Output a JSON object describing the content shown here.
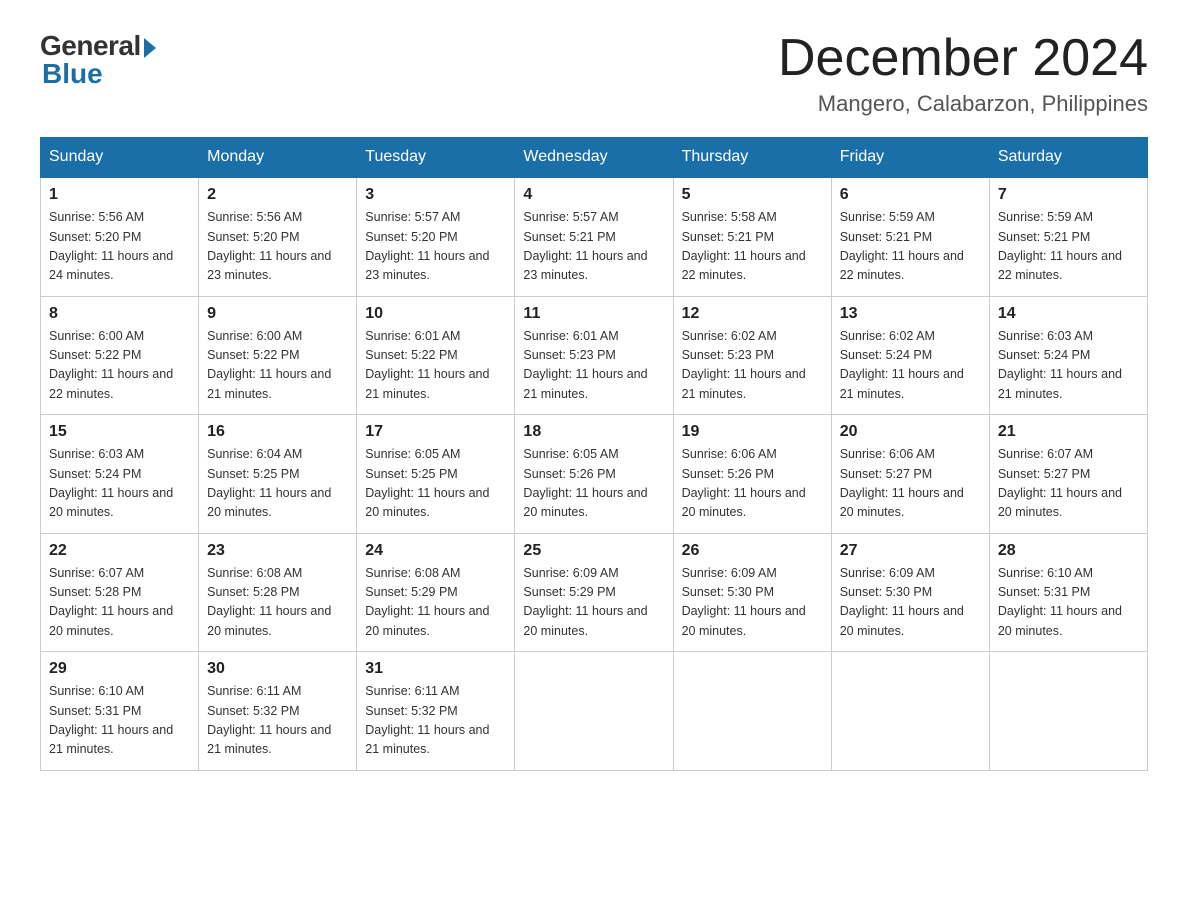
{
  "header": {
    "logo_general": "General",
    "logo_blue": "Blue",
    "month_title": "December 2024",
    "location": "Mangero, Calabarzon, Philippines"
  },
  "weekdays": [
    "Sunday",
    "Monday",
    "Tuesday",
    "Wednesday",
    "Thursday",
    "Friday",
    "Saturday"
  ],
  "weeks": [
    [
      {
        "day": "1",
        "sunrise": "Sunrise: 5:56 AM",
        "sunset": "Sunset: 5:20 PM",
        "daylight": "Daylight: 11 hours and 24 minutes."
      },
      {
        "day": "2",
        "sunrise": "Sunrise: 5:56 AM",
        "sunset": "Sunset: 5:20 PM",
        "daylight": "Daylight: 11 hours and 23 minutes."
      },
      {
        "day": "3",
        "sunrise": "Sunrise: 5:57 AM",
        "sunset": "Sunset: 5:20 PM",
        "daylight": "Daylight: 11 hours and 23 minutes."
      },
      {
        "day": "4",
        "sunrise": "Sunrise: 5:57 AM",
        "sunset": "Sunset: 5:21 PM",
        "daylight": "Daylight: 11 hours and 23 minutes."
      },
      {
        "day": "5",
        "sunrise": "Sunrise: 5:58 AM",
        "sunset": "Sunset: 5:21 PM",
        "daylight": "Daylight: 11 hours and 22 minutes."
      },
      {
        "day": "6",
        "sunrise": "Sunrise: 5:59 AM",
        "sunset": "Sunset: 5:21 PM",
        "daylight": "Daylight: 11 hours and 22 minutes."
      },
      {
        "day": "7",
        "sunrise": "Sunrise: 5:59 AM",
        "sunset": "Sunset: 5:21 PM",
        "daylight": "Daylight: 11 hours and 22 minutes."
      }
    ],
    [
      {
        "day": "8",
        "sunrise": "Sunrise: 6:00 AM",
        "sunset": "Sunset: 5:22 PM",
        "daylight": "Daylight: 11 hours and 22 minutes."
      },
      {
        "day": "9",
        "sunrise": "Sunrise: 6:00 AM",
        "sunset": "Sunset: 5:22 PM",
        "daylight": "Daylight: 11 hours and 21 minutes."
      },
      {
        "day": "10",
        "sunrise": "Sunrise: 6:01 AM",
        "sunset": "Sunset: 5:22 PM",
        "daylight": "Daylight: 11 hours and 21 minutes."
      },
      {
        "day": "11",
        "sunrise": "Sunrise: 6:01 AM",
        "sunset": "Sunset: 5:23 PM",
        "daylight": "Daylight: 11 hours and 21 minutes."
      },
      {
        "day": "12",
        "sunrise": "Sunrise: 6:02 AM",
        "sunset": "Sunset: 5:23 PM",
        "daylight": "Daylight: 11 hours and 21 minutes."
      },
      {
        "day": "13",
        "sunrise": "Sunrise: 6:02 AM",
        "sunset": "Sunset: 5:24 PM",
        "daylight": "Daylight: 11 hours and 21 minutes."
      },
      {
        "day": "14",
        "sunrise": "Sunrise: 6:03 AM",
        "sunset": "Sunset: 5:24 PM",
        "daylight": "Daylight: 11 hours and 21 minutes."
      }
    ],
    [
      {
        "day": "15",
        "sunrise": "Sunrise: 6:03 AM",
        "sunset": "Sunset: 5:24 PM",
        "daylight": "Daylight: 11 hours and 20 minutes."
      },
      {
        "day": "16",
        "sunrise": "Sunrise: 6:04 AM",
        "sunset": "Sunset: 5:25 PM",
        "daylight": "Daylight: 11 hours and 20 minutes."
      },
      {
        "day": "17",
        "sunrise": "Sunrise: 6:05 AM",
        "sunset": "Sunset: 5:25 PM",
        "daylight": "Daylight: 11 hours and 20 minutes."
      },
      {
        "day": "18",
        "sunrise": "Sunrise: 6:05 AM",
        "sunset": "Sunset: 5:26 PM",
        "daylight": "Daylight: 11 hours and 20 minutes."
      },
      {
        "day": "19",
        "sunrise": "Sunrise: 6:06 AM",
        "sunset": "Sunset: 5:26 PM",
        "daylight": "Daylight: 11 hours and 20 minutes."
      },
      {
        "day": "20",
        "sunrise": "Sunrise: 6:06 AM",
        "sunset": "Sunset: 5:27 PM",
        "daylight": "Daylight: 11 hours and 20 minutes."
      },
      {
        "day": "21",
        "sunrise": "Sunrise: 6:07 AM",
        "sunset": "Sunset: 5:27 PM",
        "daylight": "Daylight: 11 hours and 20 minutes."
      }
    ],
    [
      {
        "day": "22",
        "sunrise": "Sunrise: 6:07 AM",
        "sunset": "Sunset: 5:28 PM",
        "daylight": "Daylight: 11 hours and 20 minutes."
      },
      {
        "day": "23",
        "sunrise": "Sunrise: 6:08 AM",
        "sunset": "Sunset: 5:28 PM",
        "daylight": "Daylight: 11 hours and 20 minutes."
      },
      {
        "day": "24",
        "sunrise": "Sunrise: 6:08 AM",
        "sunset": "Sunset: 5:29 PM",
        "daylight": "Daylight: 11 hours and 20 minutes."
      },
      {
        "day": "25",
        "sunrise": "Sunrise: 6:09 AM",
        "sunset": "Sunset: 5:29 PM",
        "daylight": "Daylight: 11 hours and 20 minutes."
      },
      {
        "day": "26",
        "sunrise": "Sunrise: 6:09 AM",
        "sunset": "Sunset: 5:30 PM",
        "daylight": "Daylight: 11 hours and 20 minutes."
      },
      {
        "day": "27",
        "sunrise": "Sunrise: 6:09 AM",
        "sunset": "Sunset: 5:30 PM",
        "daylight": "Daylight: 11 hours and 20 minutes."
      },
      {
        "day": "28",
        "sunrise": "Sunrise: 6:10 AM",
        "sunset": "Sunset: 5:31 PM",
        "daylight": "Daylight: 11 hours and 20 minutes."
      }
    ],
    [
      {
        "day": "29",
        "sunrise": "Sunrise: 6:10 AM",
        "sunset": "Sunset: 5:31 PM",
        "daylight": "Daylight: 11 hours and 21 minutes."
      },
      {
        "day": "30",
        "sunrise": "Sunrise: 6:11 AM",
        "sunset": "Sunset: 5:32 PM",
        "daylight": "Daylight: 11 hours and 21 minutes."
      },
      {
        "day": "31",
        "sunrise": "Sunrise: 6:11 AM",
        "sunset": "Sunset: 5:32 PM",
        "daylight": "Daylight: 11 hours and 21 minutes."
      },
      null,
      null,
      null,
      null
    ]
  ]
}
